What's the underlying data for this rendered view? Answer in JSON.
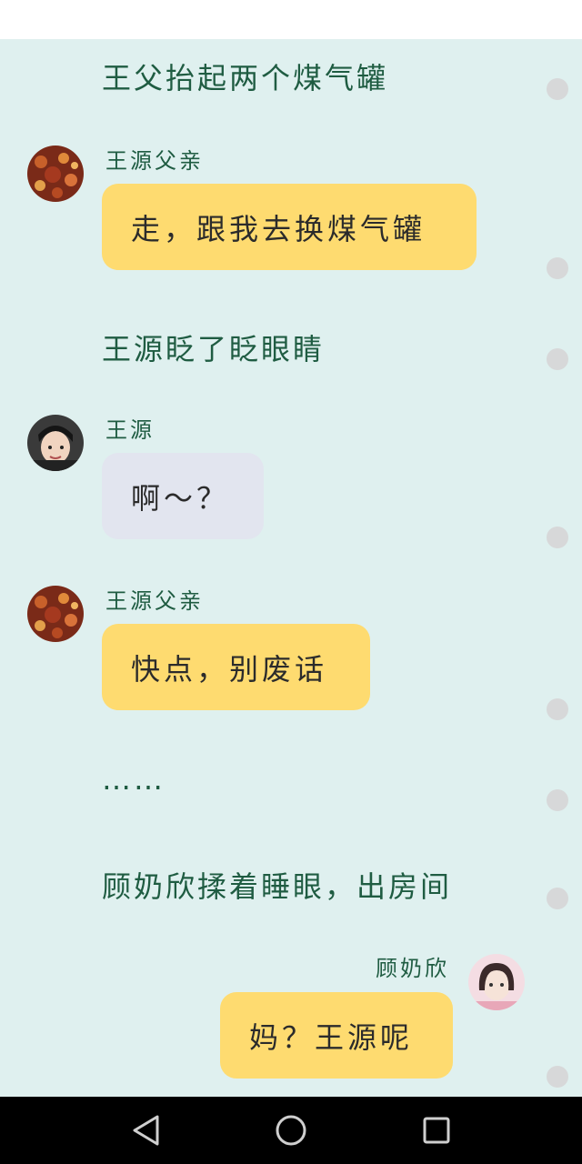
{
  "messages": [
    {
      "type": "narration",
      "text": "王父抬起两个煤气罐"
    },
    {
      "type": "message",
      "sender": "王源父亲",
      "text": "走，跟我去换煤气罐",
      "avatar": "father-avatar"
    },
    {
      "type": "narration",
      "text": "王源眨了眨眼睛"
    },
    {
      "type": "message",
      "sender": "王源",
      "text": "啊～？",
      "avatar": "boy-avatar"
    },
    {
      "type": "message",
      "sender": "王源父亲",
      "text": "快点，别废话",
      "avatar": "father-avatar"
    },
    {
      "type": "narration",
      "text": "……"
    },
    {
      "type": "narration",
      "text": "顾奶欣揉着睡眼，出房间"
    },
    {
      "type": "message",
      "sender": "顾奶欣",
      "text": "妈？王源呢",
      "avatar": "girl-avatar",
      "align": "right"
    }
  ],
  "colors": {
    "chat_background": "#dff0ef",
    "narration_text": "#1f5c42",
    "bubble_yellow": "#fedb70",
    "bubble_grey": "#e2e5ef",
    "side_dot": "#d7d8d9",
    "nav_bar": "#000000"
  },
  "navbar": {
    "buttons": [
      "back-triangle-icon",
      "home-circle-icon",
      "recents-square-icon"
    ]
  }
}
